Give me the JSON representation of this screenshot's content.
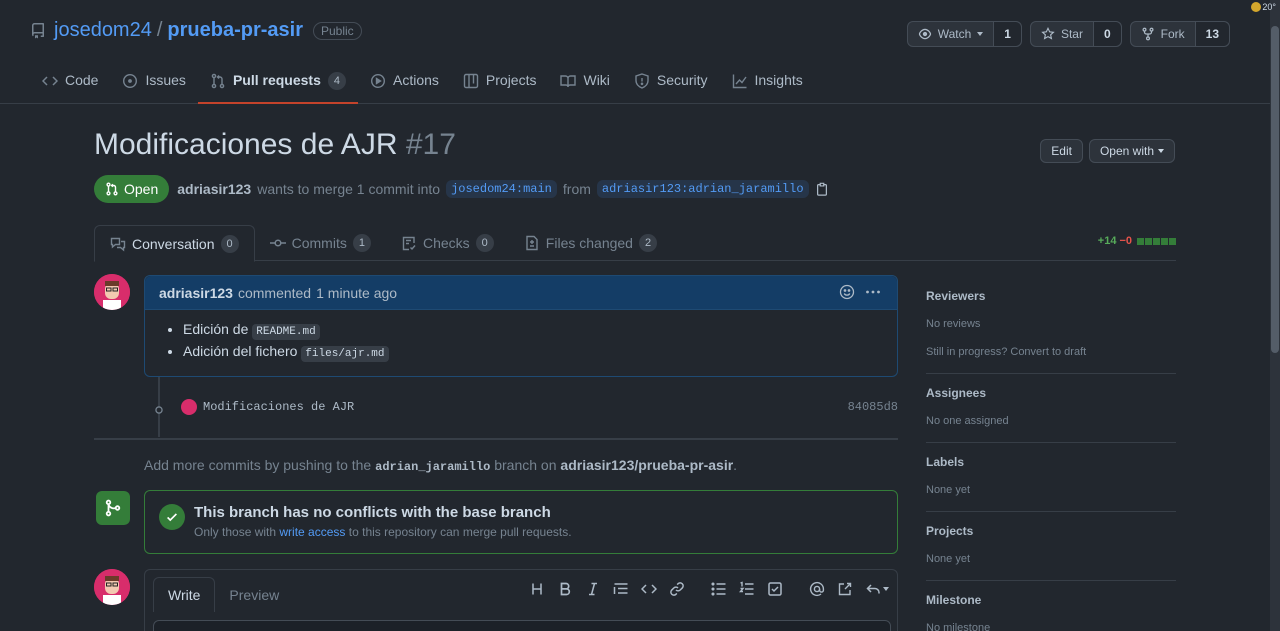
{
  "repo": {
    "owner": "josedom24",
    "separator": "/",
    "name": "prueba-pr-asir",
    "visibility": "Public",
    "watch": {
      "label": "Watch",
      "count": "1"
    },
    "star": {
      "label": "Star",
      "count": "0"
    },
    "fork": {
      "label": "Fork",
      "count": "13"
    }
  },
  "nav": {
    "code": "Code",
    "issues": "Issues",
    "pull_requests": "Pull requests",
    "pull_requests_count": "4",
    "actions": "Actions",
    "projects": "Projects",
    "wiki": "Wiki",
    "security": "Security",
    "insights": "Insights"
  },
  "weather": "20°",
  "pr": {
    "title": "Modificaciones de AJR",
    "number": "#17",
    "edit_label": "Edit",
    "open_with_label": "Open with",
    "state": "Open",
    "author": "adriasir123",
    "merge_text_1": "wants to merge 1 commit into",
    "base_ref": "josedom24:main",
    "merge_text_2": "from",
    "head_ref": "adriasir123:adrian_jaramillo"
  },
  "tabs": {
    "conversation": "Conversation",
    "conversation_count": "0",
    "commits": "Commits",
    "commits_count": "1",
    "checks": "Checks",
    "checks_count": "0",
    "files_changed": "Files changed",
    "files_changed_count": "2",
    "additions": "+14",
    "deletions": "−0"
  },
  "comment": {
    "author": "adriasir123",
    "action": "commented",
    "time": "1 minute ago",
    "items": [
      {
        "text": "Edición de",
        "code": "README.md"
      },
      {
        "text": "Adición del fichero",
        "code": "files/ajr.md"
      }
    ]
  },
  "commit": {
    "message": "Modificaciones de AJR",
    "sha": "84085d8"
  },
  "add_commits": {
    "text_1": "Add more commits by pushing to the",
    "branch": "adrian_jaramillo",
    "text_2": "branch on",
    "repo": "adriasir123/prueba-pr-asir",
    "text_3": "."
  },
  "merge": {
    "title": "This branch has no conflicts with the base branch",
    "sub_1": "Only those with",
    "link": "write access",
    "sub_2": "to this repository can merge pull requests."
  },
  "editor": {
    "write_tab": "Write",
    "preview_tab": "Preview"
  },
  "sidebar": {
    "reviewers": {
      "heading": "Reviewers",
      "value": "No reviews",
      "extra": "Still in progress? Convert to draft"
    },
    "assignees": {
      "heading": "Assignees",
      "value": "No one assigned"
    },
    "labels": {
      "heading": "Labels",
      "value": "None yet"
    },
    "projects": {
      "heading": "Projects",
      "value": "None yet"
    },
    "milestone": {
      "heading": "Milestone",
      "value": "No milestone"
    }
  },
  "colors": {
    "background": "#22272e",
    "accent_blue": "#539bf5",
    "open_green": "#347d39",
    "selected_tab_underline": "#c4432b"
  }
}
